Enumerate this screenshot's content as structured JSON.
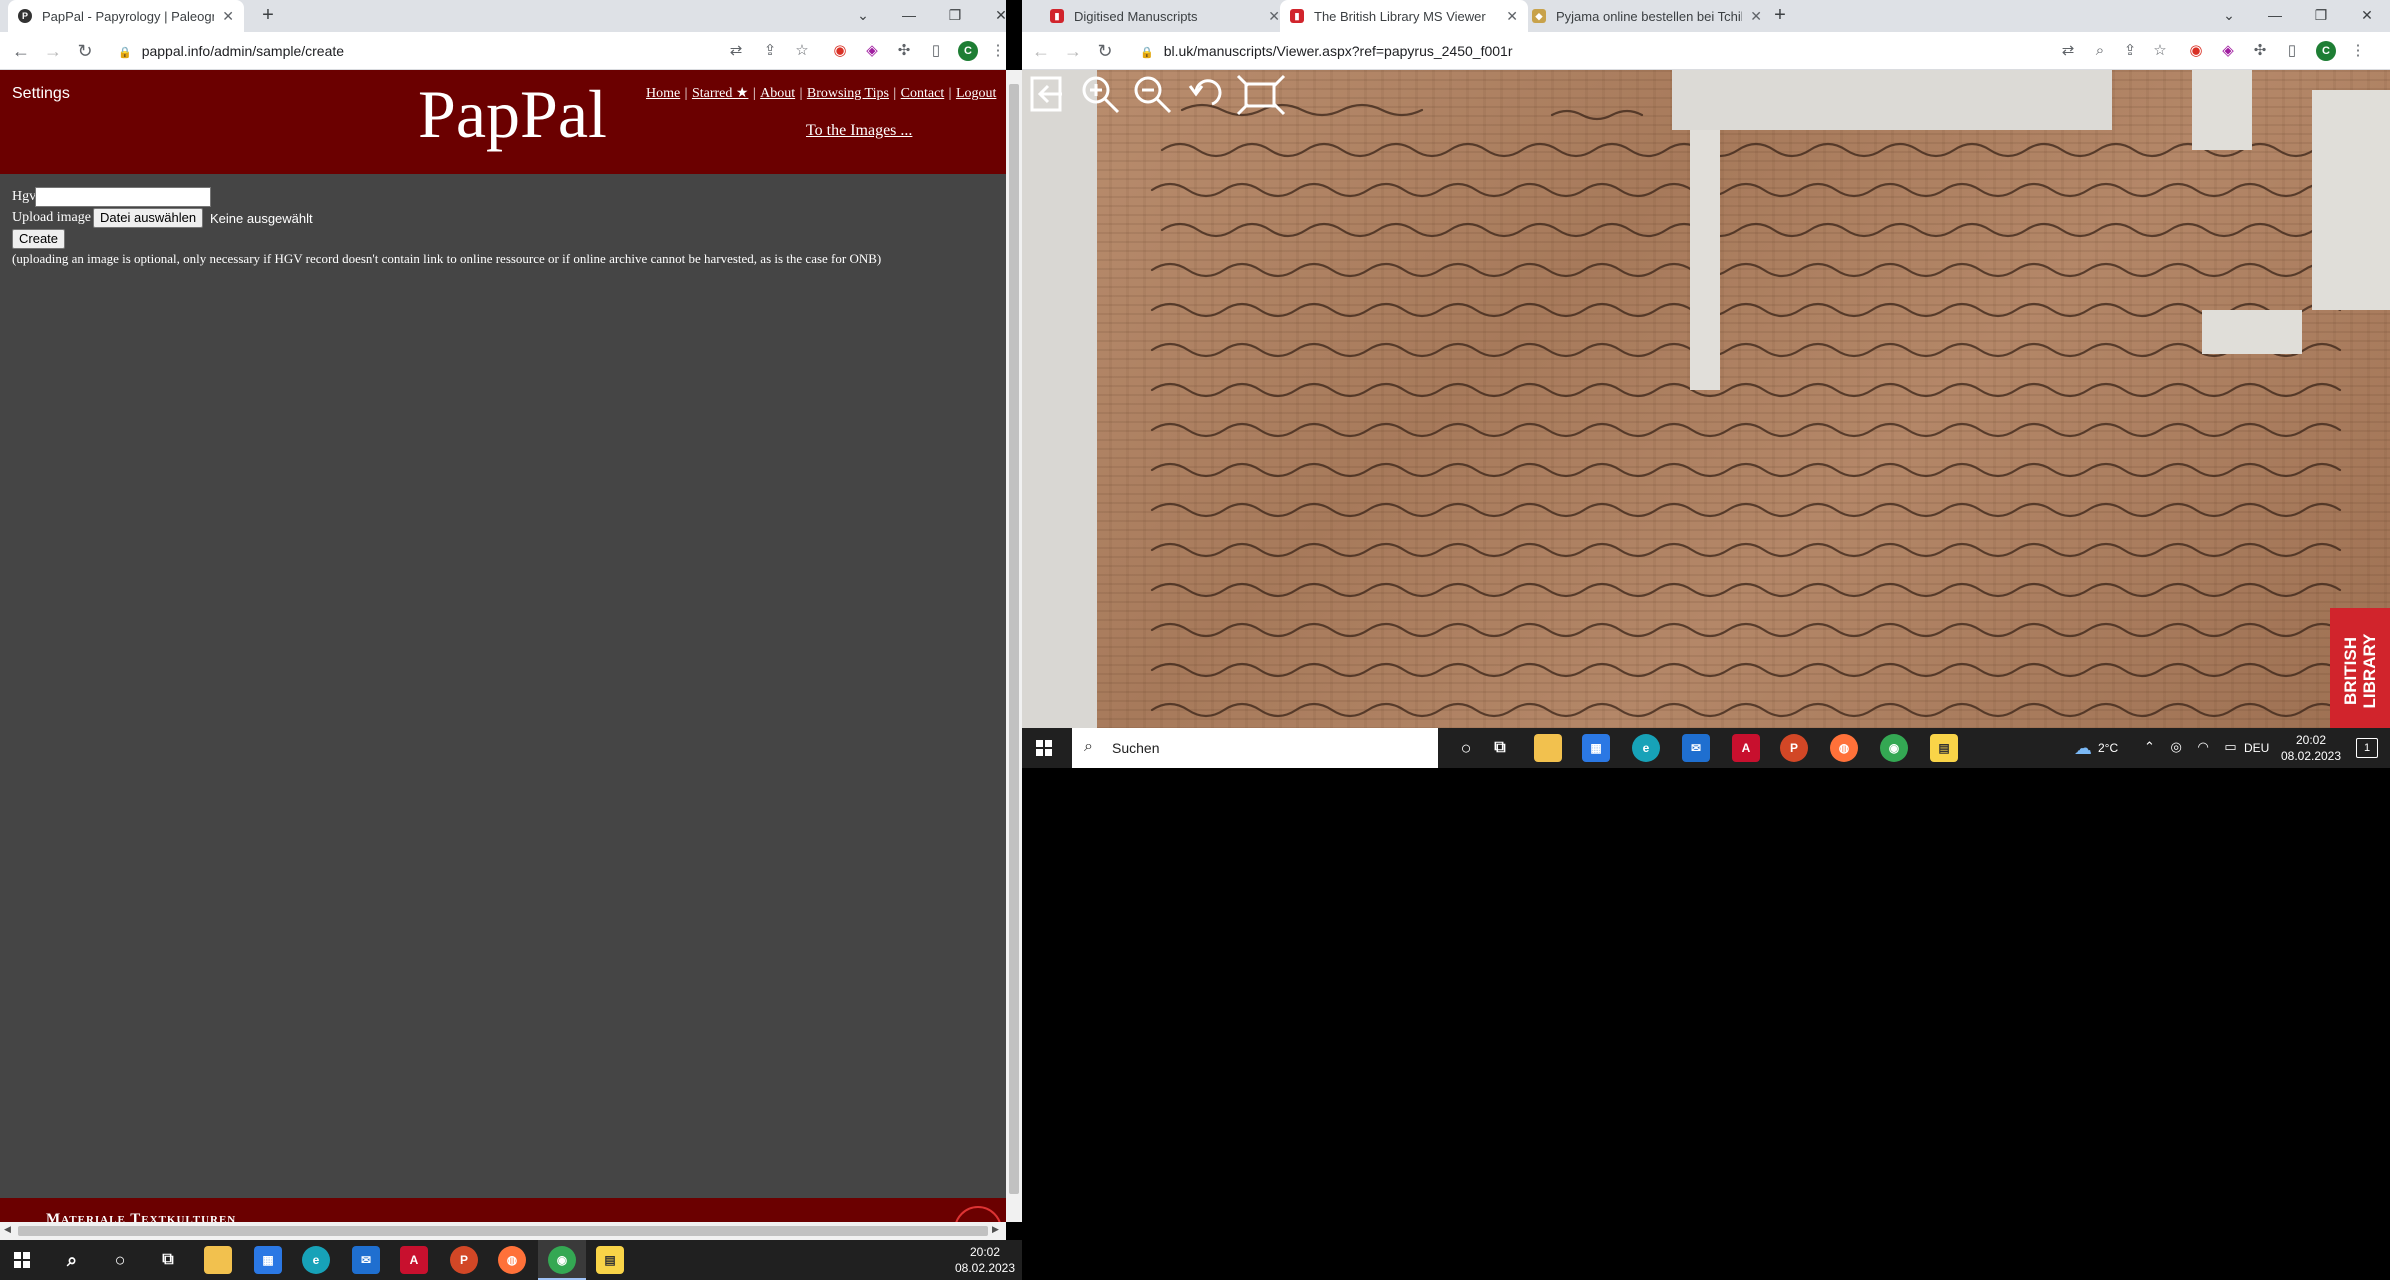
{
  "left_browser": {
    "tabs": [
      {
        "title": "PapPal - Papyrology | Paleography",
        "active": true
      }
    ],
    "new_tab": "+",
    "window_controls": [
      "⌄",
      "—",
      "❐",
      "✕"
    ],
    "url": "pappal.info/admin/sample/create",
    "page": {
      "settings": "Settings",
      "logo": "PapPal",
      "nav": [
        "Home",
        "Starred ★",
        "About",
        "Browsing Tips",
        "Contact",
        "Logout"
      ],
      "separator": "|",
      "to_images": "To the Images ...",
      "form": {
        "hgv_label": "Hgv",
        "hgv_value": "",
        "upload_label": "Upload image",
        "file_button": "Datei auswählen",
        "file_status": "Keine ausgewählt",
        "create_button": "Create",
        "note": "(uploading an image is optional, only necessary if HGV record doesn't contain link to online ressource or if online archive cannot be harvested, as is the case for ONB)"
      },
      "footer_text": "Materiale Textkulturen"
    }
  },
  "right_browser": {
    "tabs": [
      {
        "title": "Digitised Manuscripts",
        "active": false
      },
      {
        "title": "The British Library MS Viewer",
        "active": true
      },
      {
        "title": "Pyjama online bestellen bei Tchibo",
        "active": false
      }
    ],
    "new_tab": "+",
    "window_controls": [
      "⌄",
      "—",
      "❐",
      "✕"
    ],
    "url": "bl.uk/manuscripts/Viewer.aspx?ref=papyrus_2450_f001r",
    "viewer_tools": [
      "exit-icon",
      "zoom-in-icon",
      "zoom-out-icon",
      "rotate-icon",
      "fullscreen-icon"
    ],
    "badge": "BRITISH LIBRARY"
  },
  "right_taskbar": {
    "search_placeholder": "Suchen",
    "weather": "2°C",
    "language": "DEU",
    "time": "20:02",
    "date": "08.02.2023",
    "notifications": "1"
  },
  "main_taskbar": {
    "time": "20:02",
    "date": "08.02.2023"
  },
  "colors": {
    "pappal_header": "#6b0000",
    "pappal_body": "#454545",
    "taskbar": "#202020",
    "chrome_tabstrip": "#dee1e6"
  }
}
